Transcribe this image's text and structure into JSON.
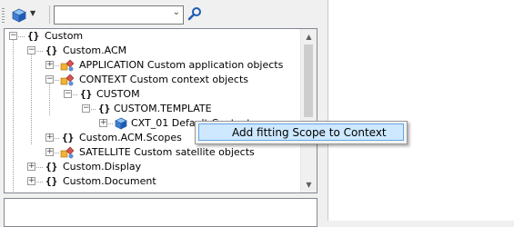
{
  "toolbar": {
    "object_type_icon": "blue-cube-icon",
    "dropdown_icon": "caret-down-icon",
    "filter_value": "",
    "search_icon": "magnifier-icon"
  },
  "tree": {
    "nodes": [
      {
        "label": "Custom",
        "icon": "braces-icon"
      },
      {
        "label": "Custom.ACM",
        "icon": "braces-icon"
      },
      {
        "label": "APPLICATION Custom application objects",
        "icon": "colored-shapes-icon"
      },
      {
        "label": "CONTEXT Custom context objects",
        "icon": "colored-shapes-icon"
      },
      {
        "label": "CUSTOM",
        "icon": "braces-icon"
      },
      {
        "label": "CUSTOM.TEMPLATE",
        "icon": "braces-icon"
      },
      {
        "label": "CXT_01 Default Context",
        "icon": "blue-cube-icon"
      },
      {
        "label": "Custom.ACM.Scopes",
        "icon": "braces-icon"
      },
      {
        "label": "SATELLITE Custom satellite objects",
        "icon": "colored-shapes-icon"
      },
      {
        "label": "Custom.Display",
        "icon": "braces-icon"
      },
      {
        "label": "Custom.Document",
        "icon": "braces-icon"
      }
    ]
  },
  "context_menu": {
    "items": [
      {
        "label": "Add fitting Scope to Context"
      }
    ]
  },
  "colors": {
    "menu_highlight": "#cde8ff",
    "menu_highlight_border": "#66a7e8",
    "tree_border": "#828790"
  }
}
